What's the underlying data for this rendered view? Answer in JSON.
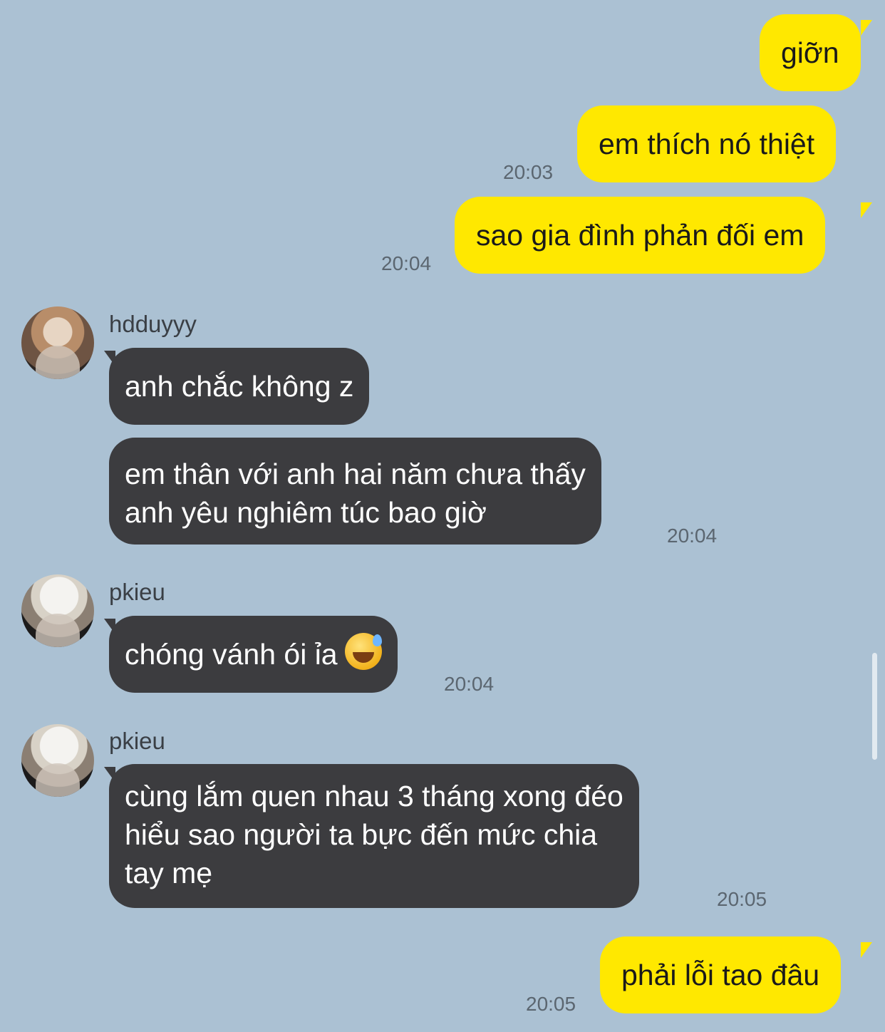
{
  "messages": [
    {
      "id": "m1",
      "text": "giỡn"
    },
    {
      "id": "m2",
      "text": "em thích nó thiệt",
      "time": "20:03"
    },
    {
      "id": "m3",
      "text": "sao gia đình phản đối em",
      "time": "20:04"
    },
    {
      "sender": "hdduyyy",
      "text": "anh chắc không z"
    },
    {
      "text_lines": [
        "em thân với anh hai năm chưa thấy",
        "anh yêu nghiêm túc bao giờ"
      ],
      "time": "20:04"
    },
    {
      "sender": "pkieu",
      "text": "chóng vánh ói ỉa",
      "emoji": "sweat-smile",
      "time": "20:04"
    },
    {
      "sender": "pkieu",
      "text_lines": [
        "cùng lắm quen nhau 3 tháng xong đéo",
        "hiểu sao người ta bực đến mức chia",
        "tay mẹ"
      ],
      "time": "20:05"
    },
    {
      "text": "phải lỗi tao đâu",
      "time": "20:05"
    }
  ]
}
